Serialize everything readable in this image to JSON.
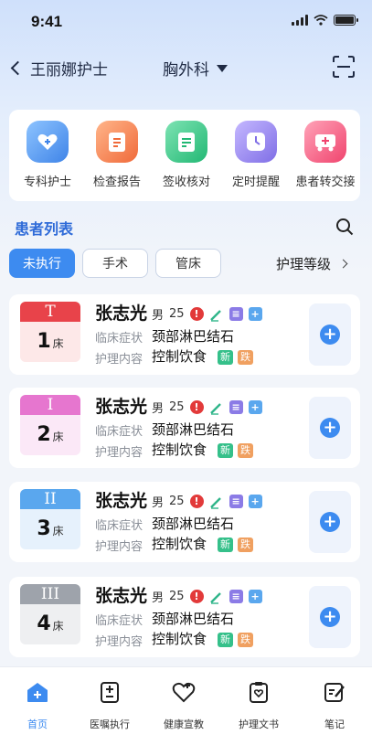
{
  "status_bar": {
    "time": "9:41"
  },
  "nav": {
    "back_label": "王丽娜护士",
    "department": "胸外科"
  },
  "quick_actions": [
    {
      "label": "专科护士",
      "icon": "heart-icon",
      "color": "#4a90e8"
    },
    {
      "label": "检查报告",
      "icon": "report-icon",
      "color": "#f07a4a"
    },
    {
      "label": "签收核对",
      "icon": "checklist-icon",
      "color": "#2fbf7f"
    },
    {
      "label": "定时提醒",
      "icon": "clock-icon",
      "color": "#8a7be8"
    },
    {
      "label": "患者转交接",
      "icon": "transfer-icon",
      "color": "#f05a7a"
    }
  ],
  "section": {
    "title": "患者列表"
  },
  "filters": {
    "tab1": "未执行",
    "tab2": "手术",
    "tab3": "管床",
    "nurse_level": "护理等级"
  },
  "labels": {
    "symptom": "临床症状",
    "content": "护理内容",
    "bed_unit": "床",
    "tag_new": "新",
    "tag_fall": "跌"
  },
  "patients": [
    {
      "level": "T",
      "level_color": "#e8434a",
      "bg": "#fde8e8",
      "bed": "1",
      "name": "张志光",
      "gender": "男",
      "age": "25",
      "symptom": "颈部淋巴结石",
      "content": "控制饮食"
    },
    {
      "level": "I",
      "level_color": "#e676cf",
      "bg": "#fbe8f7",
      "bed": "2",
      "name": "张志光",
      "gender": "男",
      "age": "25",
      "symptom": "颈部淋巴结石",
      "content": "控制饮食"
    },
    {
      "level": "II",
      "level_color": "#5aa7ee",
      "bg": "#e6f1fc",
      "bed": "3",
      "name": "张志光",
      "gender": "男",
      "age": "25",
      "symptom": "颈部淋巴结石",
      "content": "控制饮食"
    },
    {
      "level": "III",
      "level_color": "#9ea3ab",
      "bg": "#eeeff1",
      "bed": "4",
      "name": "张志光",
      "gender": "男",
      "age": "25",
      "symptom": "颈部淋巴结石",
      "content": "控制饮食"
    }
  ],
  "tabbar": [
    {
      "label": "首页",
      "icon": "home-icon"
    },
    {
      "label": "医嘱执行",
      "icon": "order-icon"
    },
    {
      "label": "健康宣教",
      "icon": "health-icon"
    },
    {
      "label": "护理文书",
      "icon": "document-icon"
    },
    {
      "label": "笔记",
      "icon": "note-icon"
    }
  ],
  "colors": {
    "accent": "#3d8bf0",
    "title_blue": "#2f6bd8"
  }
}
